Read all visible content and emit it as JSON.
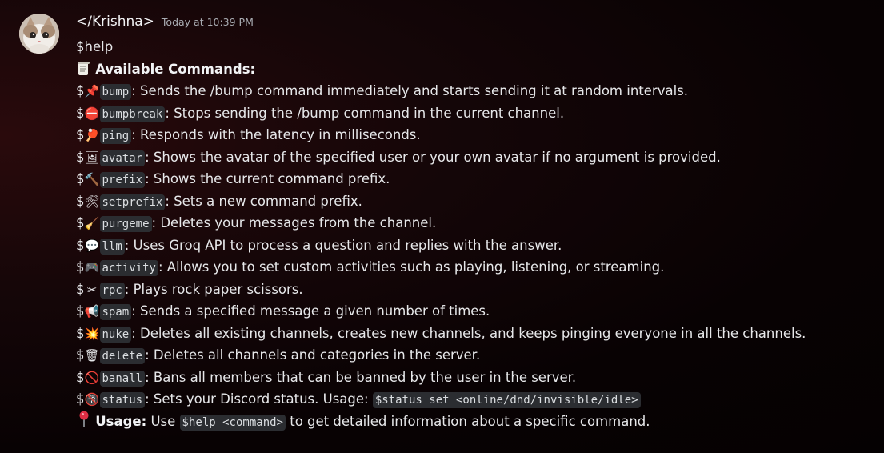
{
  "message": {
    "username": "</Krishna>",
    "timestamp": "Today at 10:39 PM",
    "command_text": "$help",
    "heading": "Available Commands:",
    "heading_icon": "scroll-icon",
    "commands": [
      {
        "prefix": "$",
        "icon": "pushpin-icon",
        "emoji": "📌",
        "name": "bump",
        "desc": ": Sends the /bump command immediately and starts sending it at random intervals."
      },
      {
        "prefix": "$",
        "icon": "no-entry-icon",
        "emoji": "⛔",
        "name": "bumpbreak",
        "desc": ": Stops sending the /bump command in the current channel."
      },
      {
        "prefix": "$",
        "icon": "ping-pong-icon",
        "emoji": "🏓",
        "name": "ping",
        "desc": ": Responds with the latency in milliseconds."
      },
      {
        "prefix": "$",
        "icon": "picture-icon",
        "emoji": "🖼",
        "name": "avatar",
        "desc": ": Shows the avatar of the specified user or your own avatar if no argument is provided."
      },
      {
        "prefix": "$",
        "icon": "hammer-icon",
        "emoji": "🔨",
        "name": "prefix",
        "desc": ": Shows the current command prefix."
      },
      {
        "prefix": "$",
        "icon": "tools-icon",
        "emoji": "🛠",
        "name": "setprefix",
        "desc": ": Sets a new command prefix."
      },
      {
        "prefix": "$",
        "icon": "broom-icon",
        "emoji": "🧹",
        "name": "purgeme",
        "desc": ": Deletes your messages from the channel."
      },
      {
        "prefix": "$",
        "icon": "speech-bubble-icon",
        "emoji": "💬",
        "name": "llm",
        "desc": ": Uses Groq API to process a question and replies with the answer."
      },
      {
        "prefix": "$",
        "icon": "game-controller-icon",
        "emoji": "🎮",
        "name": "activity",
        "desc": ": Allows you to set custom activities such as playing, listening, or streaming."
      },
      {
        "prefix": "$",
        "icon": "scissors-icon",
        "emoji": "✂",
        "name": "rpc",
        "desc": ": Plays rock paper scissors."
      },
      {
        "prefix": "$",
        "icon": "megaphone-icon",
        "emoji": "📢",
        "name": "spam",
        "desc": ": Sends a specified message a given number of times."
      },
      {
        "prefix": "$",
        "icon": "explosion-icon",
        "emoji": "💥",
        "name": "nuke",
        "desc": ": Deletes all existing channels, creates new channels, and keeps pinging everyone in all the channels."
      },
      {
        "prefix": "$",
        "icon": "wastebasket-icon",
        "emoji": "🗑",
        "name": "delete",
        "desc": ": Deletes all channels and categories in the server."
      },
      {
        "prefix": "$",
        "icon": "prohibited-icon",
        "emoji": "🚫",
        "name": "banall",
        "desc": ": Bans all members that can be banned by the user in the server."
      },
      {
        "prefix": "$",
        "icon": "no-one-under-eighteen-icon",
        "emoji": "🔞",
        "name": "status",
        "desc": ": Sets your Discord status. Usage: ",
        "extra_code": "$status set <online/dnd/invisible/idle>"
      }
    ],
    "usage": {
      "icon": "round-pushpin-icon",
      "label": "Usage:",
      "text_before": " Use ",
      "code": "$help <command>",
      "text_after": " to get detailed information about a specific command."
    }
  }
}
